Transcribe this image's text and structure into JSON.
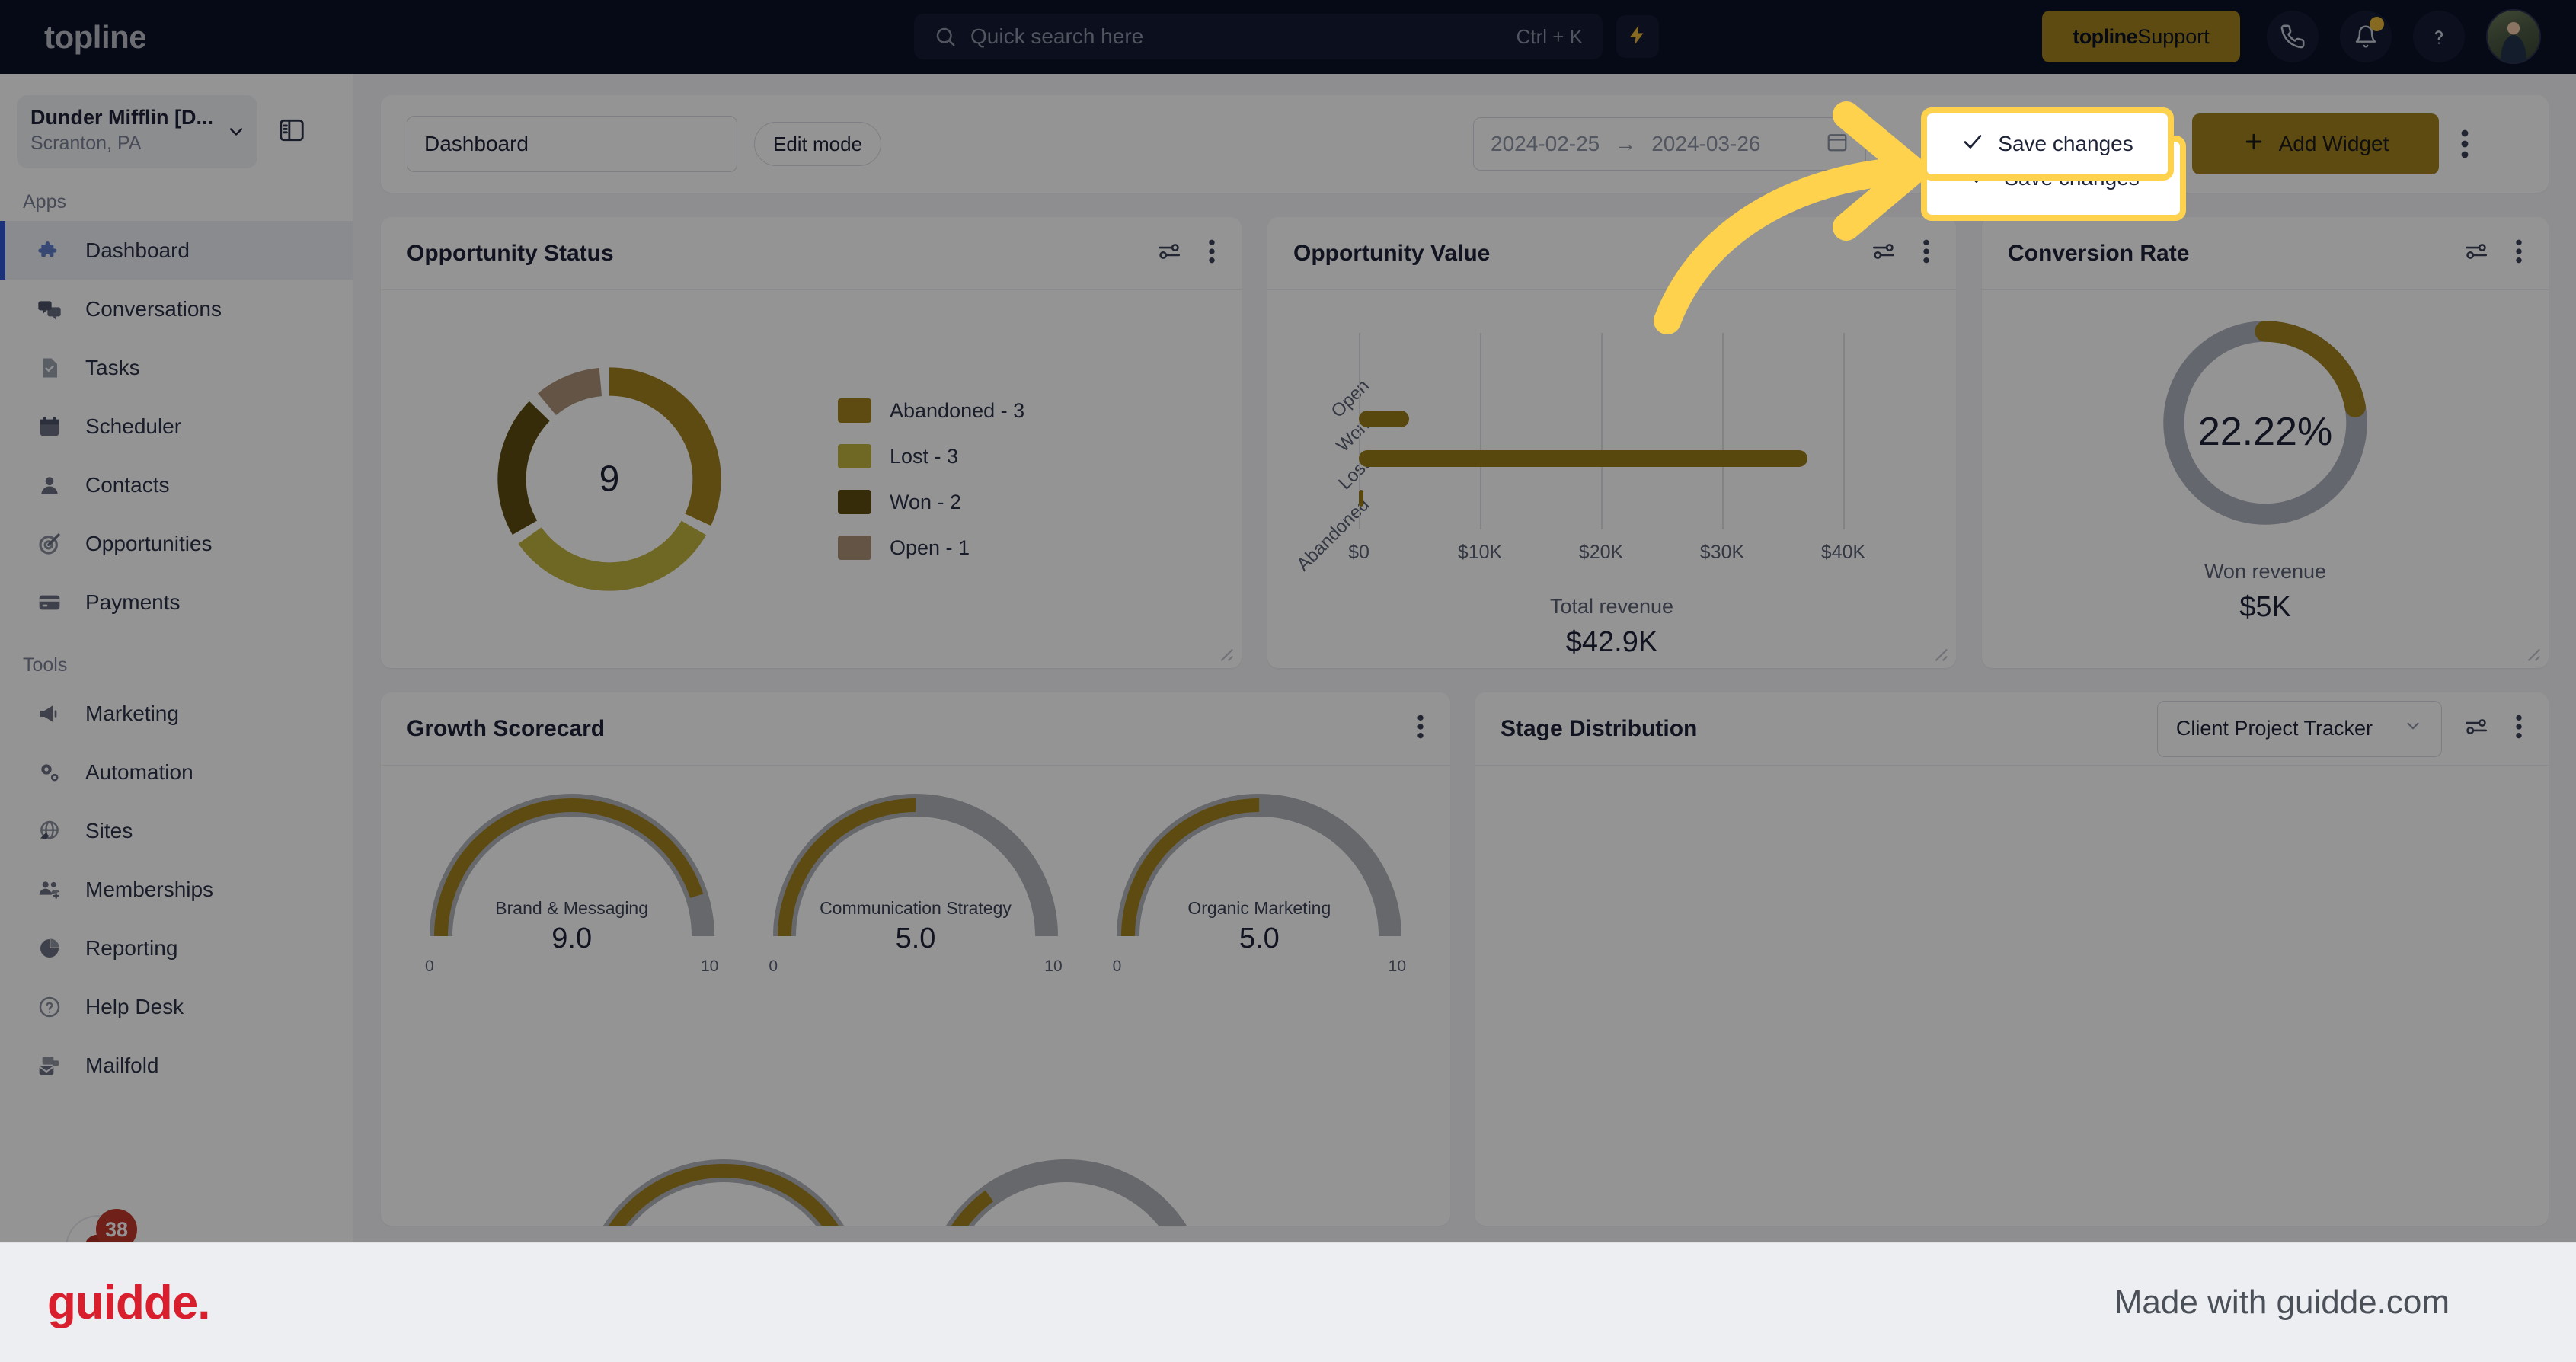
{
  "topbar": {
    "brand": "topline",
    "search": {
      "placeholder": "Quick search here",
      "shortcut": "Ctrl + K",
      "icon": "search-icon"
    },
    "bolt_icon": "lightning-bolt-icon",
    "support_button": {
      "brand": "topline",
      "label": " Support"
    },
    "phone_icon": "phone-icon",
    "bell_icon": "bell-icon",
    "help_icon": "question-mark-icon",
    "avatar": "user-avatar"
  },
  "sidebar": {
    "org": {
      "name": "Dunder Mifflin [D...",
      "location": "Scranton, PA",
      "chevron": "chevron-down-icon"
    },
    "panel_toggle_icon": "sidebar-panel-toggle-icon",
    "sections": [
      {
        "label": "Apps",
        "items": [
          {
            "label": "Dashboard",
            "icon": "puzzle-icon",
            "active": true
          },
          {
            "label": "Conversations",
            "icon": "chat-bubbles-icon",
            "active": false
          },
          {
            "label": "Tasks",
            "icon": "task-check-icon",
            "active": false
          },
          {
            "label": "Scheduler",
            "icon": "calendar-icon",
            "active": false
          },
          {
            "label": "Contacts",
            "icon": "person-icon",
            "active": false
          },
          {
            "label": "Opportunities",
            "icon": "target-icon",
            "active": false
          },
          {
            "label": "Payments",
            "icon": "credit-card-icon",
            "active": false
          }
        ]
      },
      {
        "label": "Tools",
        "items": [
          {
            "label": "Marketing",
            "icon": "megaphone-icon",
            "active": false
          },
          {
            "label": "Automation",
            "icon": "gears-icon",
            "active": false
          },
          {
            "label": "Sites",
            "icon": "globe-cursor-icon",
            "active": false
          },
          {
            "label": "Memberships",
            "icon": "people-add-icon",
            "active": false
          },
          {
            "label": "Reporting",
            "icon": "pie-chart-icon",
            "active": false
          },
          {
            "label": "Help Desk",
            "icon": "help-circle-icon",
            "active": false
          },
          {
            "label": "Mailfold",
            "icon": "mail-stack-icon",
            "active": false
          }
        ]
      }
    ],
    "chat_fab": {
      "icon": "chat-fab-icon",
      "badge": "38"
    }
  },
  "toolbar": {
    "dashboard_name": "Dashboard",
    "edit_mode_label": "Edit mode",
    "date_start": "2024-02-25",
    "date_end": "2024-03-26",
    "date_arrow": "→",
    "calendar_icon": "calendar-icon",
    "save_label": "Save changes",
    "save_check_icon": "check-icon",
    "add_widget_label": "Add Widget",
    "add_widget_plus": "+",
    "kebab_icon": "kebab-menu-icon"
  },
  "widgets": {
    "opportunity_status": {
      "title": "Opportunity Status",
      "filter_icon": "filter-sliders-icon",
      "kebab_icon": "kebab-menu-icon",
      "center_total": "9"
    },
    "opportunity_value": {
      "title": "Opportunity Value",
      "filter_icon": "filter-sliders-icon",
      "kebab_icon": "kebab-menu-icon",
      "kpi_label": "Total revenue",
      "kpi_value": "$42.9K"
    },
    "conversion_rate": {
      "title": "Conversion Rate",
      "filter_icon": "filter-sliders-icon",
      "kebab_icon": "kebab-menu-icon",
      "kpi_label": "Won revenue",
      "kpi_value": "$5K"
    },
    "growth_scorecard": {
      "title": "Growth Scorecard",
      "kebab_icon": "kebab-menu-icon"
    },
    "stage_distribution": {
      "title": "Stage Distribution",
      "selected_pipeline": "Client Project Tracker",
      "chevron_icon": "chevron-down-icon",
      "filter_icon": "filter-sliders-icon",
      "kebab_icon": "kebab-menu-icon"
    }
  },
  "annotation": {
    "arrow": "curved-yellow-arrow",
    "arrow_color": "#ffd24d",
    "highlight_color": "#ffd24d"
  },
  "footer": {
    "logo": "guidde.",
    "tagline": "Made with guidde.com"
  },
  "colors": {
    "topbar_bg": "#0b1026",
    "accent_gold": "#a3821f",
    "highlight": "#ffd24d",
    "active_nav": "#3056d3",
    "guidde_red": "#d91f2d"
  },
  "chart_data": [
    {
      "type": "pie",
      "title": "Opportunity Status",
      "center_label": "9",
      "legend_position": "right",
      "labels": [
        "Abandoned",
        "Lost",
        "Won",
        "Open"
      ],
      "values": [
        3,
        3,
        2,
        1
      ],
      "colors": [
        "#a3821f",
        "#bfb23e",
        "#5e4d10",
        "#ab9278"
      ],
      "legend_entries": [
        "Abandoned - 3",
        "Lost - 3",
        "Won - 2",
        "Open - 1"
      ]
    },
    {
      "type": "bar",
      "title": "Opportunity Value",
      "orientation": "horizontal",
      "categories": [
        "Open",
        "Won",
        "Lost",
        "Abandoned"
      ],
      "values": [
        0,
        4000,
        37000,
        250
      ],
      "xlabel": "",
      "ylabel": "",
      "xlim": [
        0,
        44000
      ],
      "xticks": [
        "$0",
        "$10K",
        "$20K",
        "$30K",
        "$40K"
      ],
      "xtick_values": [
        0,
        10000,
        20000,
        30000,
        40000
      ],
      "grid": true,
      "bar_color": "#9a7c18",
      "total_label": "Total revenue",
      "total_value": "$42.9K"
    },
    {
      "type": "pie",
      "subtype": "gauge-donut",
      "title": "Conversion Rate",
      "center_label": "22.22%",
      "values": [
        22.22,
        77.78
      ],
      "colors": [
        "#a3821f",
        "#aeb2bf"
      ],
      "kpi_label": "Won revenue",
      "kpi_value": "$5K"
    },
    {
      "type": "bar",
      "subtype": "gauges",
      "title": "Growth Scorecard",
      "categories": [
        "Brand & Messaging",
        "Communication Strategy",
        "Organic Marketing"
      ],
      "values": [
        9.0,
        5.0,
        5.0
      ],
      "value_labels": [
        "9.0",
        "5.0",
        "5.0"
      ],
      "ylim": [
        0,
        10
      ],
      "min_label": "0",
      "max_label": "10",
      "track_color": "#b0b3ba",
      "fill_color": "#a3821f"
    }
  ]
}
